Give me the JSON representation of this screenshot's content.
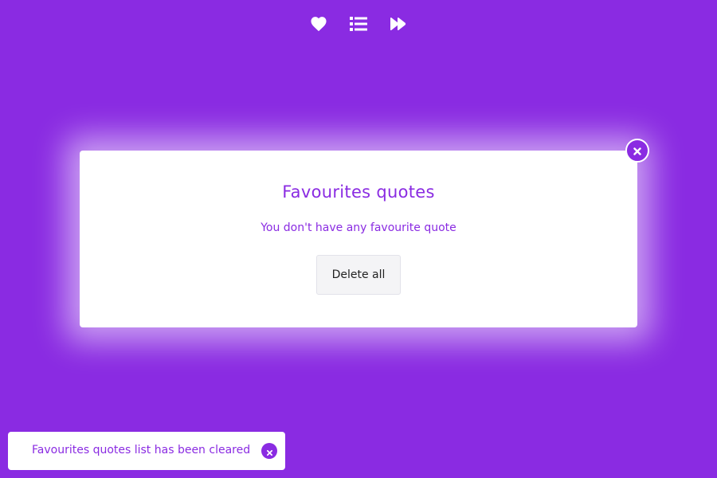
{
  "colors": {
    "background": "#8a2be2",
    "accent": "#8a2be2",
    "surface": "#ffffff",
    "button_bg": "#f4f4f6"
  },
  "topnav": {
    "items": [
      {
        "icon": "heart-icon"
      },
      {
        "icon": "list-icon"
      },
      {
        "icon": "fast-forward-icon"
      }
    ]
  },
  "modal": {
    "title": "Favourites quotes",
    "message": "You don't have any favourite quote",
    "delete_label": "Delete all",
    "close_icon": "close-icon"
  },
  "toast": {
    "message": "Favourites quotes list has been cleared",
    "close_icon": "close-icon"
  }
}
